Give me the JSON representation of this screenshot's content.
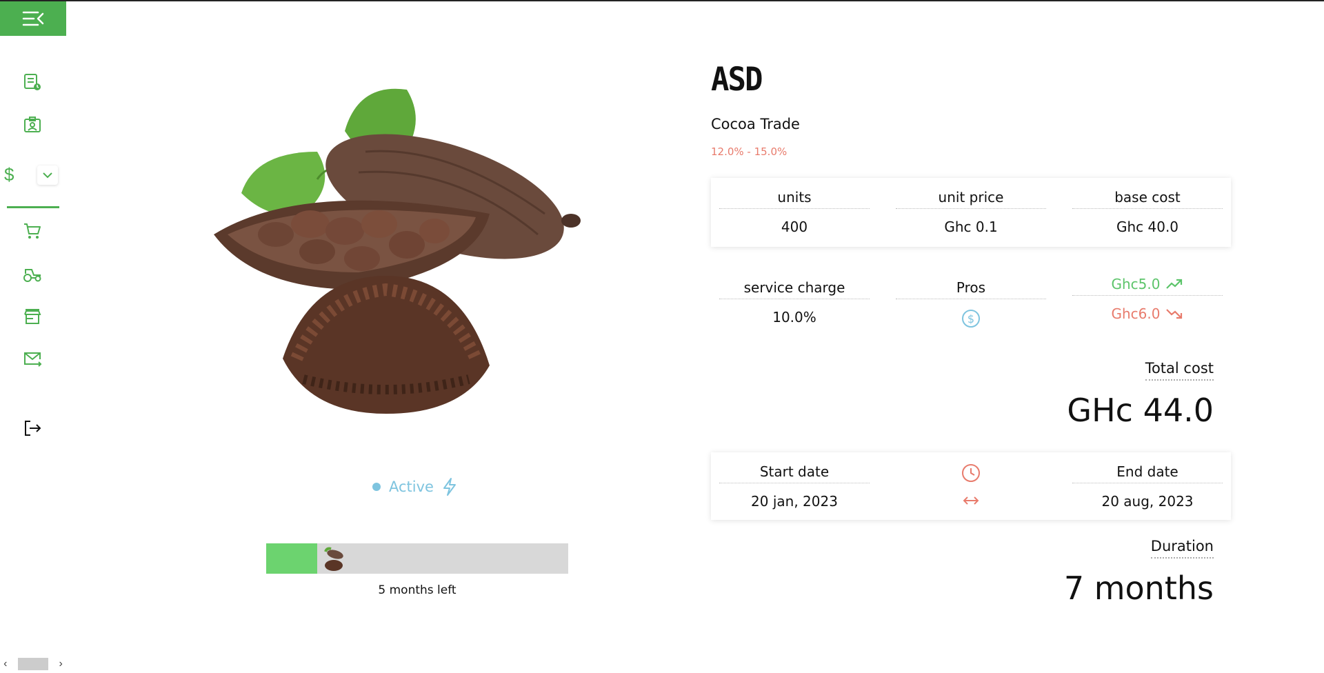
{
  "sidebar": {
    "icons": [
      "menu-collapse-icon",
      "report-clock-icon",
      "id-card-icon",
      "dollar-icon",
      "cart-icon",
      "tractor-icon",
      "store-icon",
      "mail-send-icon",
      "logout-icon"
    ],
    "dollar_symbol": "$",
    "accent_color": "#4caf50"
  },
  "product": {
    "title": "ASD",
    "subtitle": "Cocoa Trade",
    "range": "12.0% - 15.0%",
    "status": "Active",
    "progress_fraction": 0.17,
    "progress_text": "5 months left"
  },
  "pricing": {
    "units_label": "units",
    "units_value": "400",
    "unit_price_label": "unit price",
    "unit_price_value": "Ghc 0.1",
    "base_cost_label": "base cost",
    "base_cost_value": "Ghc 40.0",
    "service_label": "service charge",
    "service_value": "10.0%",
    "pros_label": "Pros",
    "gain_value": "Ghc5.0",
    "loss_value": "Ghc6.0",
    "total_label": "Total cost",
    "total_value": "GHc 44.0"
  },
  "dates": {
    "start_label": "Start date",
    "start_value": "20 jan, 2023",
    "end_label": "End date",
    "end_value": "20 aug, 2023",
    "duration_label": "Duration",
    "duration_value": "7 months"
  },
  "colors": {
    "gain": "#5cc46a",
    "loss": "#e87b6c",
    "status": "#7ec4df"
  }
}
